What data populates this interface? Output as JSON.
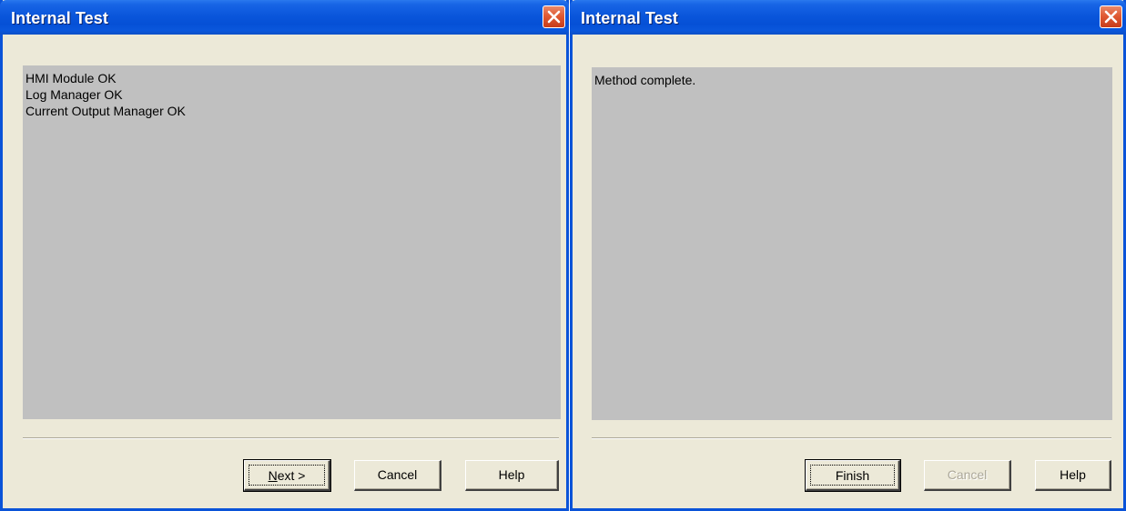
{
  "dialogs": [
    {
      "title": "Internal Test",
      "content_lines": [
        "HMI Module OK",
        "Log Manager OK",
        "Current Output Manager OK"
      ],
      "buttons": {
        "next": {
          "mnemonic": "N",
          "rest": "ext >"
        },
        "cancel": "Cancel",
        "help": "Help"
      }
    },
    {
      "title": "Internal Test",
      "content_lines": [
        "Method complete."
      ],
      "buttons": {
        "finish": "Finish",
        "cancel": "Cancel",
        "help": "Help"
      }
    }
  ],
  "icons": {
    "close": "close-icon"
  },
  "colors": {
    "titlebar": "#0a56db",
    "window_bg": "#ece9d8",
    "content_bg": "#c0c0c0",
    "close_button": "#e05a33",
    "disabled_text": "#aca899"
  }
}
